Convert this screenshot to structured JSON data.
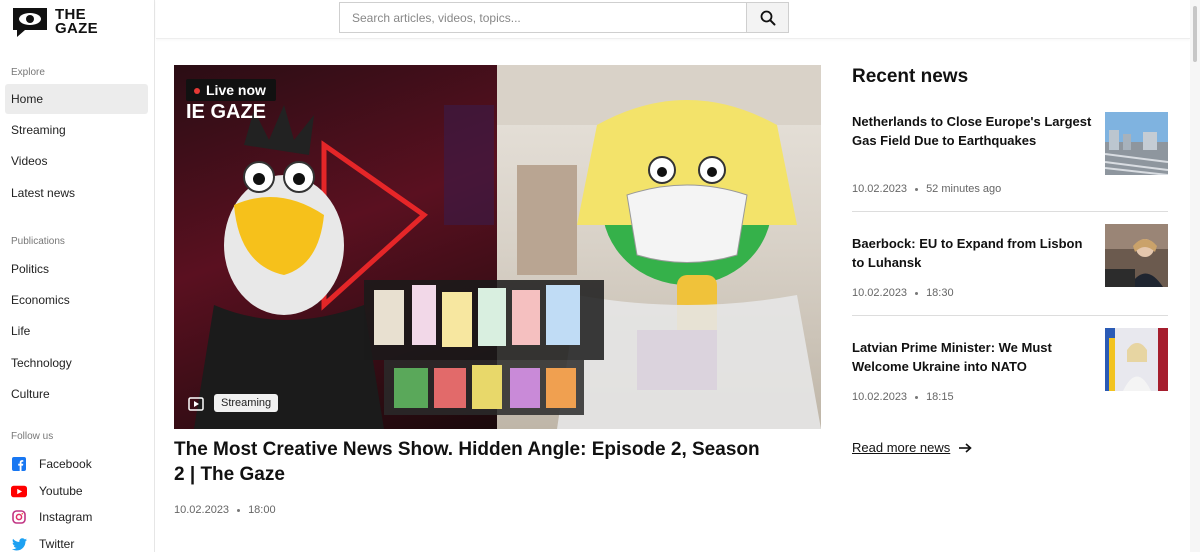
{
  "brand": {
    "logo_line1": "THE",
    "logo_line2": "GAZE"
  },
  "sidebar": {
    "explore_label": "Explore",
    "explore_items": [
      "Home",
      "Streaming",
      "Videos",
      "Latest news"
    ],
    "publications_label": "Publications",
    "publication_items": [
      "Politics",
      "Economics",
      "Life",
      "Technology",
      "Culture"
    ],
    "follow_label": "Follow us",
    "social": [
      {
        "label": "Facebook",
        "icon": "facebook-icon",
        "color": "#1877f2"
      },
      {
        "label": "Youtube",
        "icon": "youtube-icon",
        "color": "#ff0000"
      },
      {
        "label": "Instagram",
        "icon": "instagram-icon",
        "color": "#c13584"
      },
      {
        "label": "Twitter",
        "icon": "twitter-icon",
        "color": "#1da1f2"
      }
    ]
  },
  "search": {
    "placeholder": "Search articles, videos, topics..."
  },
  "hero": {
    "live_label": "Live now",
    "logo_text": "IE GAZE",
    "tag": "Streaming",
    "title": "The Most Creative News Show. Hidden Angle: Episode 2, Season 2 | The Gaze",
    "date": "10.02.2023",
    "time": "18:00"
  },
  "recent": {
    "title": "Recent news",
    "items": [
      {
        "headline": "Netherlands to Close Europe's Largest Gas Field Due to Earthquakes",
        "date": "10.02.2023",
        "time": "52 minutes ago"
      },
      {
        "headline": "Baerbock: EU to Expand from Lisbon to Luhansk",
        "date": "10.02.2023",
        "time": "18:30"
      },
      {
        "headline": "Latvian Prime Minister: We Must Welcome Ukraine into NATO",
        "date": "10.02.2023",
        "time": "18:15"
      }
    ],
    "read_more": "Read more news"
  }
}
